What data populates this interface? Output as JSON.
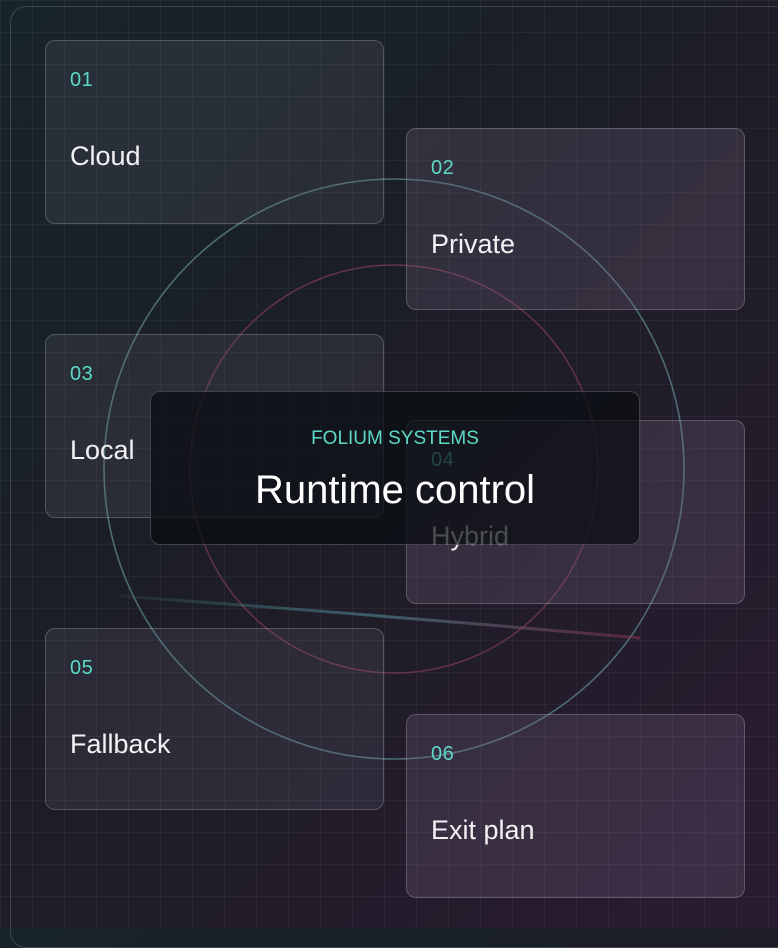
{
  "hub": {
    "eyebrow": "FOLIUM SYSTEMS",
    "title": "Runtime control"
  },
  "nodes": [
    {
      "number": "01",
      "label": "Cloud"
    },
    {
      "number": "02",
      "label": "Private"
    },
    {
      "number": "03",
      "label": "Local"
    },
    {
      "number": "04",
      "label": "Hybrid"
    },
    {
      "number": "05",
      "label": "Fallback"
    },
    {
      "number": "06",
      "label": "Exit plan"
    }
  ],
  "colors": {
    "accent": "#5ed9c8",
    "outer_ring": "#5a8088",
    "inner_ring": "#7a3a55"
  }
}
